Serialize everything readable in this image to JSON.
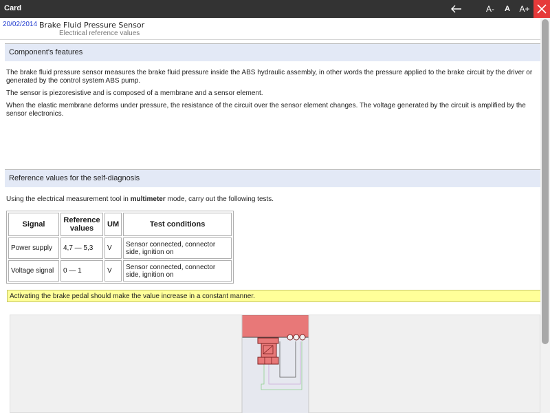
{
  "window": {
    "title": "Card",
    "buttons": {
      "back_icon": "arrow-left-icon",
      "font_smaller": "A-",
      "font_normal": "A",
      "font_larger": "A+",
      "close_icon": "close-icon",
      "close_color": "#e63a3a"
    }
  },
  "header": {
    "date": "20/02/2014",
    "title": "Brake Fluid Pressure Sensor",
    "subtitle": "Electrical reference values"
  },
  "features": {
    "heading": "Component's features",
    "paragraphs": [
      "The brake fluid pressure sensor measures the brake fluid pressure inside the ABS hydraulic assembly, in other words the pressure applied to the brake circuit by the driver or generated by the control system ABS pump.",
      "The sensor is piezoresistive and is composed of a membrane and a sensor element.",
      "When the elastic membrane deforms under pressure, the resistance of the circuit over the sensor element changes. The voltage generated by the circuit is amplified by the sensor electronics."
    ]
  },
  "diagnosis": {
    "heading": "Reference values for the self-diagnosis",
    "intro_before": "Using the electrical measurement tool in ",
    "intro_bold": "multimeter",
    "intro_after": " mode, carry out the following tests.",
    "table": {
      "headers": [
        "Signal",
        "Reference values",
        "UM",
        "Test conditions"
      ],
      "rows": [
        [
          "Power supply",
          "4,7 — 5,3",
          "V",
          "Sensor connected, connector side, ignition on"
        ],
        [
          "Voltage signal",
          "0 — 1",
          "V",
          "Sensor connected, connector side, ignition on"
        ]
      ]
    },
    "note": "Activating the brake pedal should make the value increase in a constant manner.",
    "note_color": "#ffff99"
  },
  "colors": {
    "titlebar": "#333333",
    "section_header": "#e3e9f6",
    "date_link": "#1f3bd0",
    "diagram_red": "#e87878"
  }
}
